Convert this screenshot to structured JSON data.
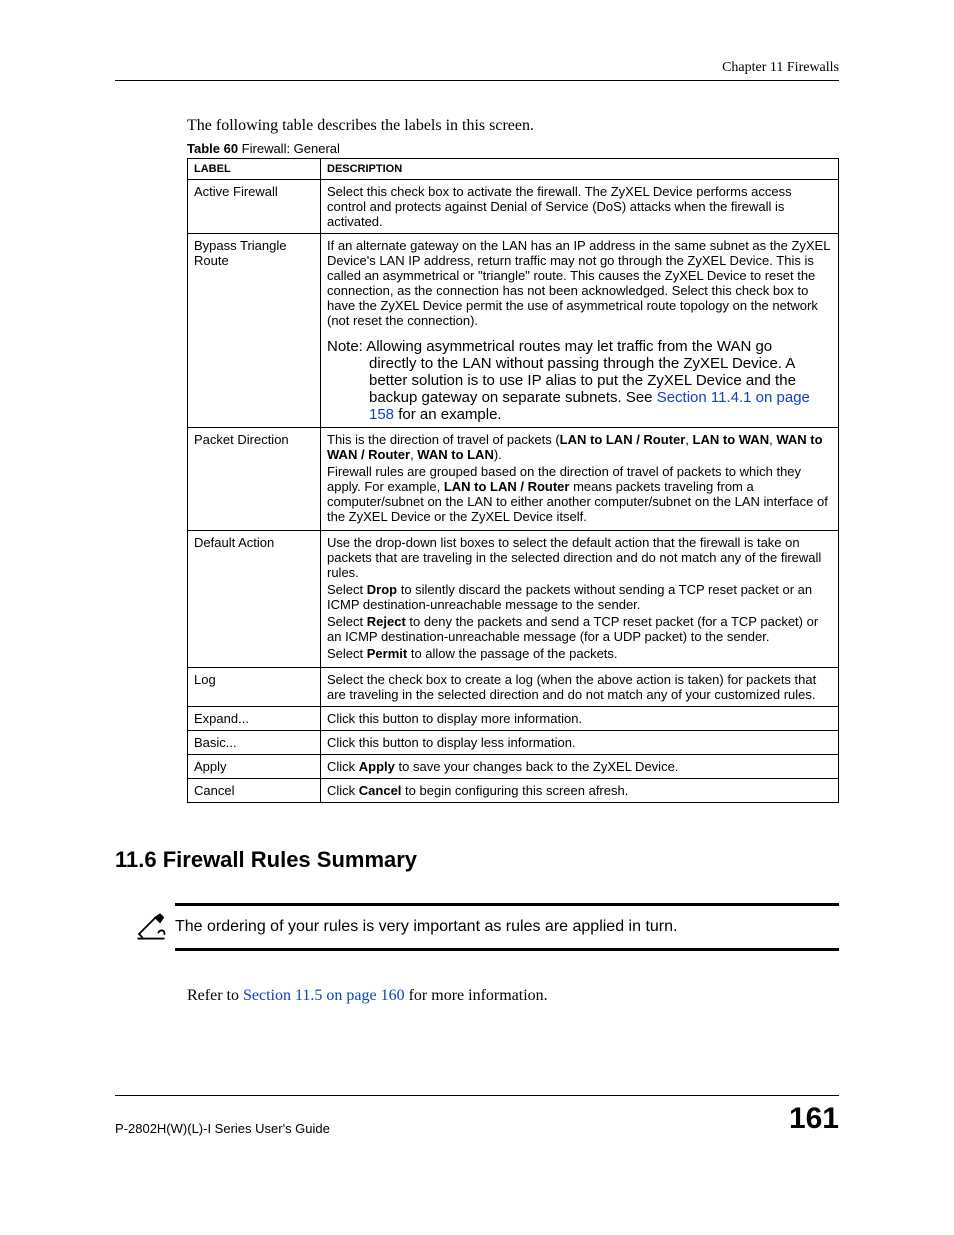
{
  "header": {
    "chapter": "Chapter 11 Firewalls"
  },
  "intro": "The following table describes the labels in this screen.",
  "table_caption": {
    "bold": "Table 60",
    "rest": "   Firewall: General"
  },
  "columns": {
    "label": "LABEL",
    "description": "DESCRIPTION"
  },
  "rows": {
    "active_firewall": {
      "label": "Active Firewall",
      "desc": "Select this check box to activate the firewall. The ZyXEL Device performs access control and protects against Denial of Service (DoS) attacks when the firewall is activated."
    },
    "bypass": {
      "label": "Bypass Triangle Route",
      "desc": "If an alternate gateway on the LAN has an IP address in the same subnet as the ZyXEL Device's LAN IP address, return traffic may not go through the ZyXEL Device. This is called an asymmetrical or \"triangle\" route. This causes the ZyXEL Device to reset the connection, as the connection has not been acknowledged. Select this check box to have the ZyXEL Device permit the use of asymmetrical route topology on the network (not reset the connection).",
      "note_lead": "Note: Allowing asymmetrical routes may let traffic from the WAN go ",
      "note_cont": "directly to the LAN without passing through the ZyXEL Device. A better solution is to use IP alias to put the ZyXEL Device and the backup gateway on separate subnets. See ",
      "note_link": "Section 11.4.1 on page 158",
      "note_tail": " for an example."
    },
    "packet_direction": {
      "label": "Packet Direction",
      "p1_a": "This is the direction of travel of packets (",
      "p1_b": "LAN to LAN / Router",
      "p1_c": ", ",
      "p1_d": "LAN to WAN",
      "p1_e": ", ",
      "p1_f": "WAN to WAN / Router",
      "p1_g": ", ",
      "p1_h": "WAN to LAN",
      "p1_i": ").",
      "p2_a": "Firewall rules are grouped based on the direction of travel of packets to which they apply. For example, ",
      "p2_b": "LAN to LAN / Router",
      "p2_c": " means packets traveling from a computer/subnet on the LAN to either another computer/subnet on the LAN interface of the ZyXEL Device or the ZyXEL Device itself."
    },
    "default_action": {
      "label": "Default Action",
      "p1": "Use the drop-down list boxes to select the default action that the firewall is take on packets that are traveling in the selected direction and do not match any of the firewall rules.",
      "p2_a": "Select ",
      "p2_b": "Drop",
      "p2_c": " to silently discard the packets without sending a TCP reset packet or an ICMP destination-unreachable message to the sender.",
      "p3_a": "Select ",
      "p3_b": "Reject",
      "p3_c": " to deny the packets and send a TCP reset packet (for a TCP packet) or an ICMP destination-unreachable message (for a UDP packet) to the sender.",
      "p4_a": "Select ",
      "p4_b": "Permit",
      "p4_c": " to allow the passage of the packets."
    },
    "log": {
      "label": "Log",
      "desc": "Select the check box to create a log (when the above action is taken) for packets that are traveling in the selected direction and do not match any of your customized rules."
    },
    "expand": {
      "label": "Expand...",
      "desc": "Click this button to display more information."
    },
    "basic": {
      "label": "Basic...",
      "desc": "Click this button to display less information."
    },
    "apply": {
      "label": "Apply",
      "desc_a": "Click ",
      "desc_b": "Apply",
      "desc_c": " to save your changes back to the ZyXEL Device."
    },
    "cancel": {
      "label": "Cancel",
      "desc_a": "Click ",
      "desc_b": "Cancel",
      "desc_c": " to begin configuring this screen afresh."
    }
  },
  "section_heading": "11.6  Firewall Rules Summary",
  "callout": "The ordering of your rules is very important as rules are applied in turn.",
  "post": {
    "a": "Refer to ",
    "link": "Section 11.5 on page 160",
    "b": " for more information."
  },
  "footer": {
    "left": "P-2802H(W)(L)-I Series User's Guide",
    "right": "161"
  }
}
